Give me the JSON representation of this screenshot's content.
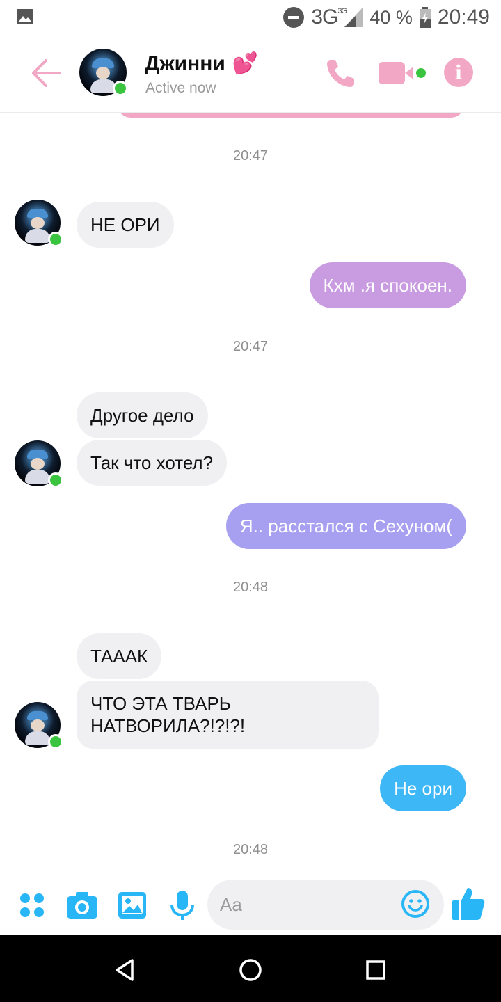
{
  "status_bar": {
    "network": "3G",
    "network_sup": "3G",
    "battery": "40 %",
    "time": "20:49"
  },
  "header": {
    "contact_name": "Джинни",
    "name_emoji": "💕",
    "status": "Active now",
    "accent_color": "#f2a7c4"
  },
  "messages": {
    "ts1": "20:47",
    "m1": "НЕ ОРИ",
    "m2": "Кхм .я спокоен.",
    "ts2": "20:47",
    "m3": "Другое дело",
    "m4": "Так что хотел?",
    "m5": "Я.. расстался с Сехуном(",
    "ts3": "20:48",
    "m6": "ТАААК",
    "m7": "ЧТО ЭТА ТВАРЬ НАТВОРИЛА?!?!?!",
    "m8": "Не ори",
    "ts4": "20:48"
  },
  "bubble_colors": {
    "m2": "#c99be0",
    "m5": "#a79ff0",
    "m8": "#3db7f5"
  },
  "composer": {
    "placeholder": "Aa",
    "icons": [
      "apps-icon",
      "camera-icon",
      "gallery-icon",
      "microphone-icon",
      "emoji-icon",
      "like-icon"
    ]
  },
  "nav": {
    "icons": [
      "back-triangle-icon",
      "home-circle-icon",
      "recents-square-icon"
    ]
  }
}
